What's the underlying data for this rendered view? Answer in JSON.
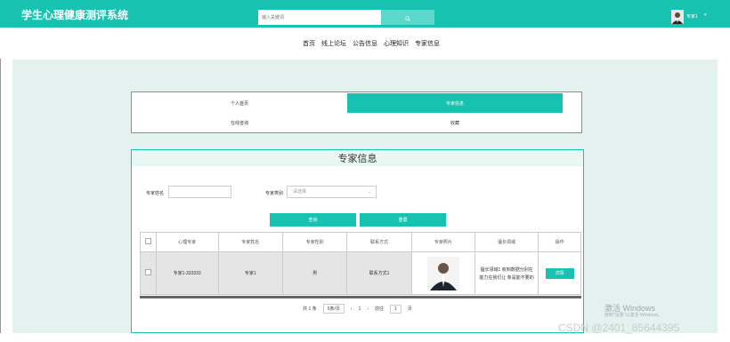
{
  "app": {
    "title": "学生心理健康测评系统"
  },
  "search": {
    "placeholder": "输入关键词"
  },
  "user": {
    "name": "专家1",
    "caret": "▾"
  },
  "nav": {
    "items": [
      "首页",
      "线上论坛",
      "公告信息",
      "心理知识",
      "专家信息"
    ]
  },
  "tabs": {
    "items": [
      "个人首页",
      "专家信息",
      "在线咨询",
      "收藏"
    ],
    "active": "专家信息"
  },
  "panel": {
    "title": "专家信息"
  },
  "filters": {
    "name_label": "专家姓名",
    "name_value": "",
    "category_label": "专家类别",
    "category_placeholder": "请选择",
    "category_caret": "⌄"
  },
  "buttons": {
    "search": "查询",
    "reset": "重置"
  },
  "table": {
    "headers": [
      "心理专家",
      "专家姓名",
      "专家性别",
      "联系方式",
      "专家照片",
      "擅长领域",
      "操作"
    ],
    "rows": [
      {
        "account": "专家1-333333",
        "name": "专家1",
        "gender": "男",
        "contact": "联系方式1",
        "specialty_line1": "擅长领域1 收到数据分别在",
        "specialty_line2": "能力在我们让 象是能不要的",
        "action": "详情"
      }
    ]
  },
  "pager": {
    "total": "共 1 条",
    "per_page": "5条/页",
    "prev": "‹",
    "page": "1",
    "next": "›",
    "goto_label": "前往",
    "goto_value": "1",
    "goto_suffix": "页"
  },
  "watermark": {
    "line1": "激活 Windows",
    "line2": "转到\"设置\"以激活 Windows。",
    "source": "CSDN @2401_85644395"
  },
  "colors": {
    "accent": "#17c3b0",
    "background": "#e4f2ef"
  }
}
